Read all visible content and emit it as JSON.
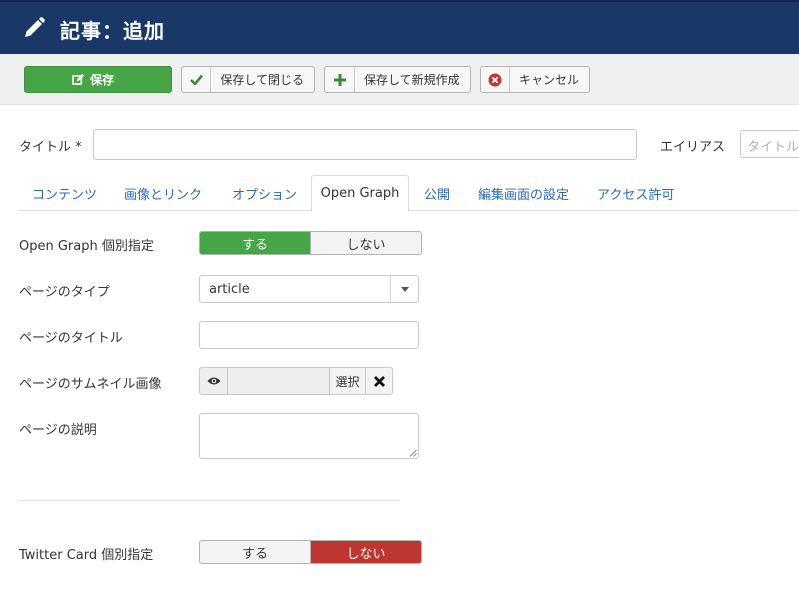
{
  "header": {
    "title": "記事：追加",
    "icon": "pencil-icon",
    "bg_color": "#1a3867"
  },
  "toolbar": {
    "save": "保存",
    "save_close": "保存して閉じる",
    "save_new": "保存して新規作成",
    "cancel": "キャンセル"
  },
  "title_field": {
    "label": "タイトル *",
    "value": ""
  },
  "alias_field": {
    "label": "エイリアス",
    "placeholder": "タイトル"
  },
  "tabs": [
    {
      "label": "コンテンツ",
      "active": false
    },
    {
      "label": "画像とリンク",
      "active": false
    },
    {
      "label": "オプション",
      "active": false
    },
    {
      "label": "Open Graph",
      "active": true
    },
    {
      "label": "公開",
      "active": false
    },
    {
      "label": "編集画面の設定",
      "active": false
    },
    {
      "label": "アクセス許可",
      "active": false
    }
  ],
  "og": {
    "individual": {
      "label": "Open Graph 個別指定",
      "yes": "する",
      "no": "しない",
      "selected": "する"
    },
    "type": {
      "label": "ページのタイプ",
      "value": "article"
    },
    "page_title": {
      "label": "ページのタイトル",
      "value": ""
    },
    "thumbnail": {
      "label": "ページのサムネイル画像",
      "select_label": "選択"
    },
    "description": {
      "label": "ページの説明",
      "value": ""
    }
  },
  "twitter": {
    "label": "Twitter Card 個別指定",
    "yes": "する",
    "no": "しない",
    "selected": "しない"
  },
  "colors": {
    "green": "#46a546",
    "red": "#bd362f",
    "link": "#2a69b8"
  }
}
